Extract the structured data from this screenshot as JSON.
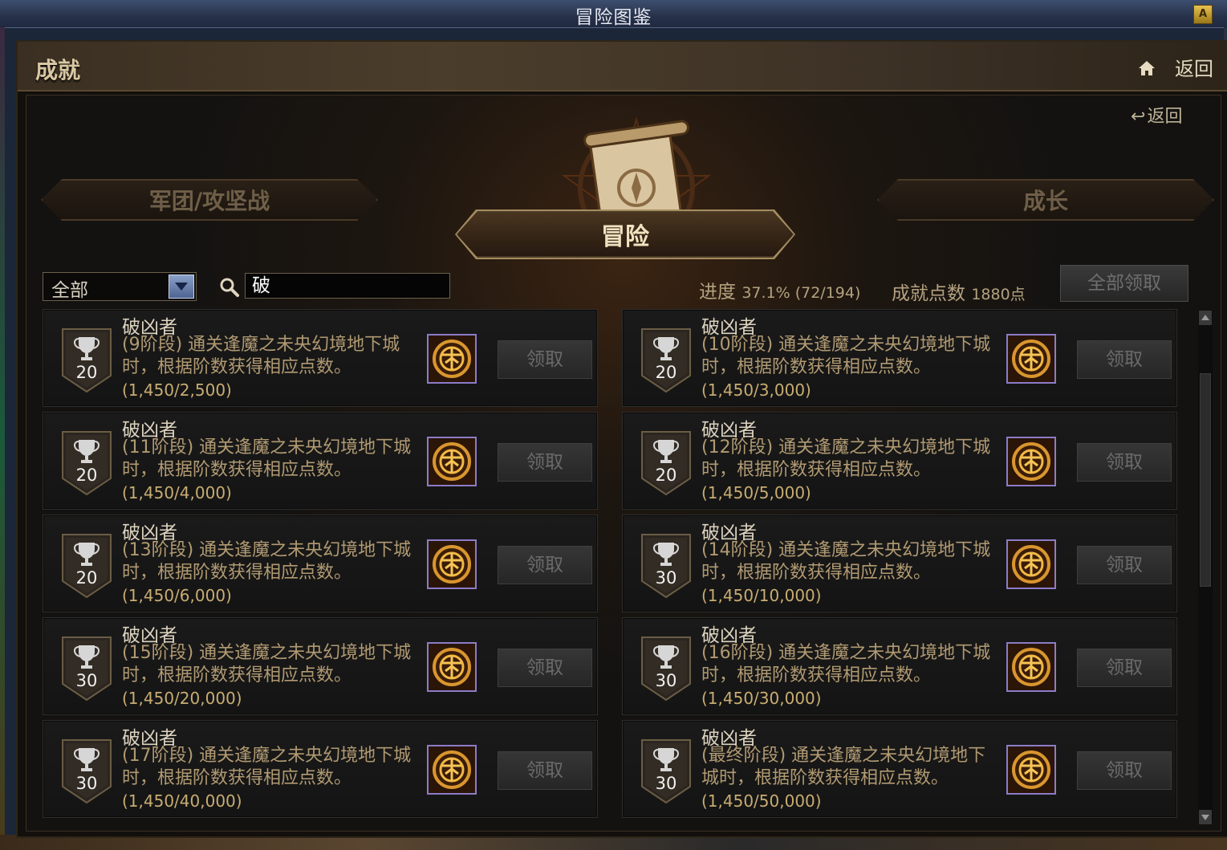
{
  "window": {
    "title": "冒险图鉴",
    "lock_label": "A"
  },
  "header": {
    "title": "成就",
    "back_label": "返回"
  },
  "sub_back_label": "返回",
  "categories": {
    "left": "军团/攻坚战",
    "active": "冒险",
    "right": "成长"
  },
  "filter": {
    "selected": "全部"
  },
  "search": {
    "value": "破"
  },
  "stats": {
    "progress_label": "进度",
    "progress_value": "37.1% (72/194)",
    "points_label": "成就点数",
    "points_value": "1880点"
  },
  "claim_all_label": "全部领取",
  "achievements": [
    {
      "title": "破凶者",
      "desc": "(9阶段) 通关逢魔之未央幻境地下城时，根据阶数获得相应点数。",
      "progress": "(1,450/2,500)",
      "points": "20",
      "button": "领取"
    },
    {
      "title": "破凶者",
      "desc": "(10阶段) 通关逢魔之未央幻境地下城时，根据阶数获得相应点数。",
      "progress": "(1,450/3,000)",
      "points": "20",
      "button": "领取"
    },
    {
      "title": "破凶者",
      "desc": "(11阶段) 通关逢魔之未央幻境地下城时，根据阶数获得相应点数。",
      "progress": "(1,450/4,000)",
      "points": "20",
      "button": "领取"
    },
    {
      "title": "破凶者",
      "desc": "(12阶段) 通关逢魔之未央幻境地下城时，根据阶数获得相应点数。",
      "progress": "(1,450/5,000)",
      "points": "20",
      "button": "领取"
    },
    {
      "title": "破凶者",
      "desc": "(13阶段) 通关逢魔之未央幻境地下城时，根据阶数获得相应点数。",
      "progress": "(1,450/6,000)",
      "points": "20",
      "button": "领取"
    },
    {
      "title": "破凶者",
      "desc": "(14阶段) 通关逢魔之未央幻境地下城时，根据阶数获得相应点数。",
      "progress": "(1,450/10,000)",
      "points": "30",
      "button": "领取"
    },
    {
      "title": "破凶者",
      "desc": "(15阶段) 通关逢魔之未央幻境地下城时，根据阶数获得相应点数。",
      "progress": "(1,450/20,000)",
      "points": "30",
      "button": "领取"
    },
    {
      "title": "破凶者",
      "desc": "(16阶段) 通关逢魔之未央幻境地下城时，根据阶数获得相应点数。",
      "progress": "(1,450/30,000)",
      "points": "30",
      "button": "领取"
    },
    {
      "title": "破凶者",
      "desc": "(17阶段) 通关逢魔之未央幻境地下城时，根据阶数获得相应点数。",
      "progress": "(1,450/40,000)",
      "points": "30",
      "button": "领取"
    },
    {
      "title": "破凶者",
      "desc": "(最终阶段) 通关逢魔之未央幻境地下城时，根据阶数获得相应点数。",
      "progress": "(1,450/50,000)",
      "points": "30",
      "button": "领取"
    }
  ]
}
